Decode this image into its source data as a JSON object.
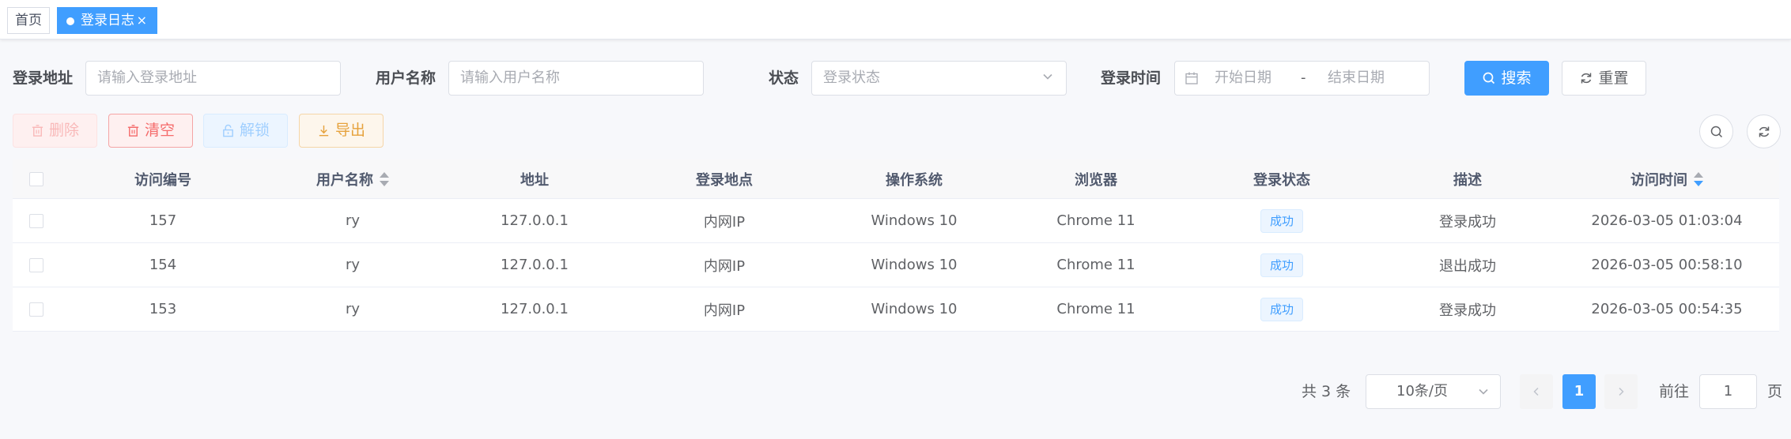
{
  "tags": {
    "home_label": "首页",
    "active_label": "登录日志",
    "close_glyph": "×"
  },
  "search": {
    "ipaddr_label": "登录地址",
    "ipaddr_placeholder": "请输入登录地址",
    "username_label": "用户名称",
    "username_placeholder": "请输入用户名称",
    "status_label": "状态",
    "status_placeholder": "登录状态",
    "time_label": "登录时间",
    "start_placeholder": "开始日期",
    "date_separator": "-",
    "end_placeholder": "结束日期",
    "search_button": "搜索",
    "reset_button": "重置"
  },
  "toolbar": {
    "delete_label": "删除",
    "clear_label": "清空",
    "unlock_label": "解锁",
    "export_label": "导出"
  },
  "table": {
    "columns": [
      "访问编号",
      "用户名称",
      "地址",
      "登录地点",
      "操作系统",
      "浏览器",
      "登录状态",
      "描述",
      "访问时间"
    ],
    "rows": [
      {
        "id": "157",
        "user": "ry",
        "ip": "127.0.0.1",
        "location": "内网IP",
        "os": "Windows 10",
        "browser": "Chrome 11",
        "status": "成功",
        "msg": "登录成功",
        "time": "2026-03-05 01:03:04"
      },
      {
        "id": "154",
        "user": "ry",
        "ip": "127.0.0.1",
        "location": "内网IP",
        "os": "Windows 10",
        "browser": "Chrome 11",
        "status": "成功",
        "msg": "退出成功",
        "time": "2026-03-05 00:58:10"
      },
      {
        "id": "153",
        "user": "ry",
        "ip": "127.0.0.1",
        "location": "内网IP",
        "os": "Windows 10",
        "browser": "Chrome 11",
        "status": "成功",
        "msg": "登录成功",
        "time": "2026-03-05 00:54:35"
      }
    ]
  },
  "pagination": {
    "total_text": "共 3 条",
    "page_size": "10条/页",
    "current_page": "1",
    "goto_prefix": "前往",
    "goto_value": "1",
    "goto_suffix": "页"
  },
  "colors": {
    "primary": "#409eff",
    "danger": "#f56c6c",
    "warning": "#e6a23c"
  }
}
